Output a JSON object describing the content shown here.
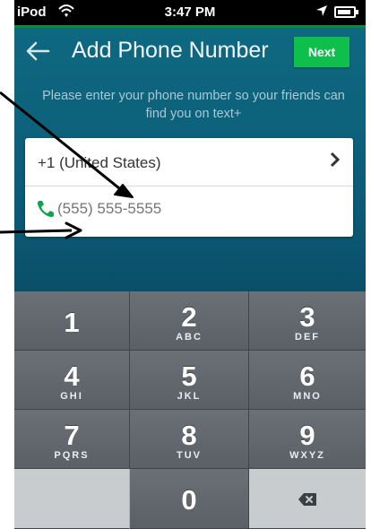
{
  "status_bar": {
    "carrier": "iPod",
    "wifi_icon": "wifi-icon",
    "time": "3:47 PM",
    "location_icon": "location-arrow-icon",
    "battery_icon": "battery-icon"
  },
  "header": {
    "back_icon": "arrow-left-icon",
    "title": "Add Phone Number",
    "next_label": "Next"
  },
  "hint": "Please enter your phone number so your friends can find you on text+",
  "form": {
    "country": "+1 (United States)",
    "chevron_icon": "chevron-right-icon",
    "phone_icon": "phone-icon",
    "phone_placeholder": "(555) 555-5555"
  },
  "keypad": {
    "keys": [
      {
        "num": "1",
        "letters": ""
      },
      {
        "num": "2",
        "letters": "ABC"
      },
      {
        "num": "3",
        "letters": "DEF"
      },
      {
        "num": "4",
        "letters": "GHI"
      },
      {
        "num": "5",
        "letters": "JKL"
      },
      {
        "num": "6",
        "letters": "MNO"
      },
      {
        "num": "7",
        "letters": "PQRS"
      },
      {
        "num": "8",
        "letters": "TUV"
      },
      {
        "num": "9",
        "letters": "WXYZ"
      },
      {
        "num": "",
        "letters": ""
      },
      {
        "num": "0",
        "letters": ""
      },
      {
        "num": "",
        "letters": ""
      }
    ],
    "backspace_icon": "backspace-icon"
  },
  "colors": {
    "accent_green": "#0ec04b",
    "background_teal": "#0c5d78"
  }
}
